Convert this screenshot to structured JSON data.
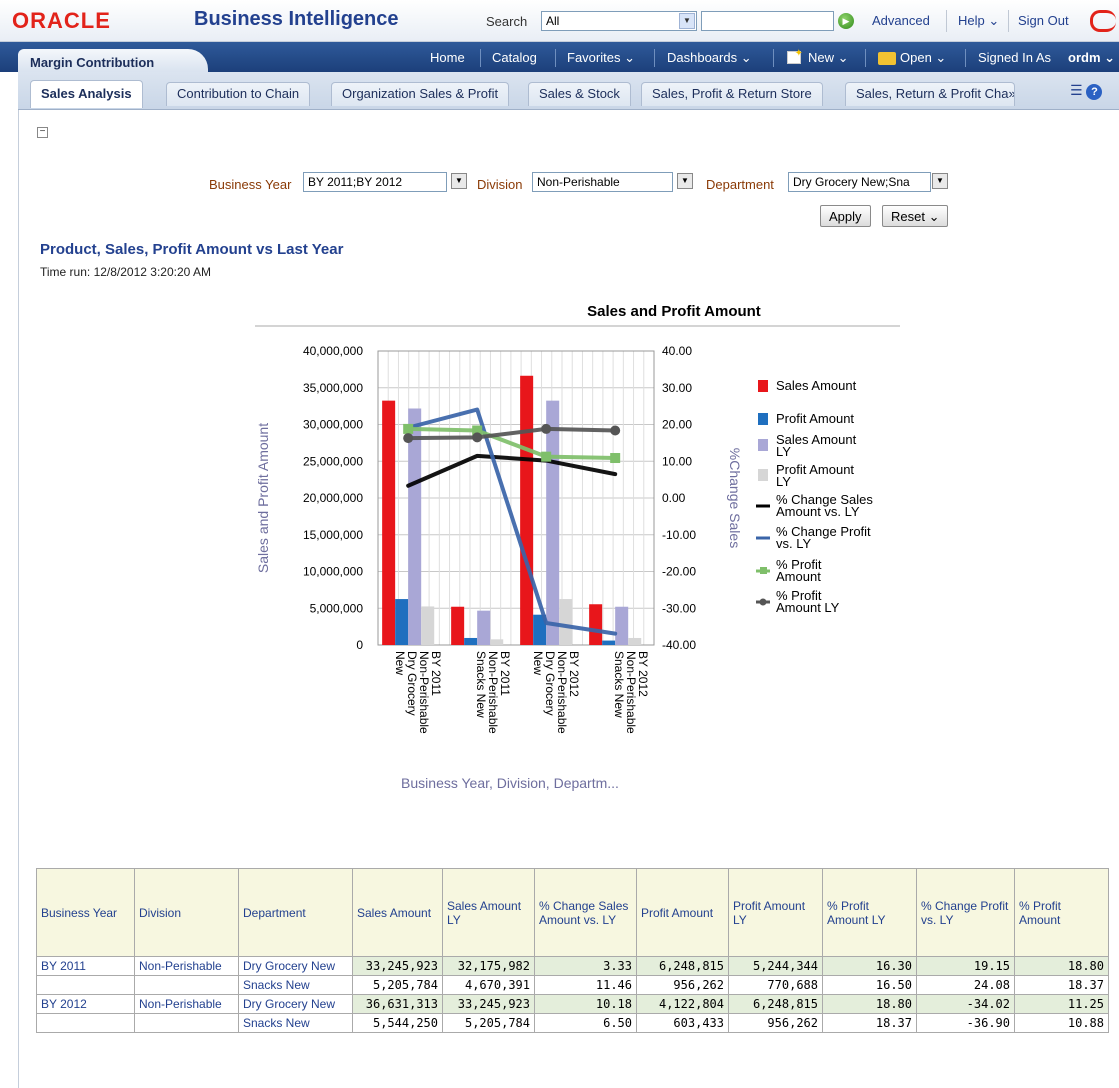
{
  "header": {
    "logo": "ORACLE",
    "product": "Business Intelligence",
    "search_label": "Search",
    "search_scope": "All",
    "advanced": "Advanced",
    "help": "Help ⌄",
    "signout": "Sign Out"
  },
  "nav": {
    "dashboard_title": "Margin Contribution",
    "home": "Home",
    "catalog": "Catalog",
    "favorites": "Favorites ⌄",
    "dashboards": "Dashboards ⌄",
    "new": "New ⌄",
    "open": "Open ⌄",
    "signed_in_as": "Signed In As",
    "user": "ordm ⌄"
  },
  "tabs": [
    "Sales Analysis",
    "Contribution to Chain",
    "Organization Sales & Profit",
    "Sales & Stock",
    "Sales, Profit & Return Store",
    "Sales, Return & Profit Cha»"
  ],
  "prompts": {
    "business_year_label": "Business Year",
    "business_year_value": "BY 2011;BY 2012",
    "division_label": "Division",
    "division_value": "Non-Perishable",
    "department_label": "Department",
    "department_value": "Dry Grocery New;Sna",
    "apply": "Apply",
    "reset": "Reset ⌄"
  },
  "report": {
    "title": "Product, Sales, Profit Amount vs Last Year",
    "time_run": "Time run: 12/8/2012 3:20:20 AM"
  },
  "chart_data": {
    "type": "bar",
    "title": "Sales and Profit Amount",
    "ylabel": "Sales and Profit Amount",
    "y2label": "%Change Sales",
    "xlabel": "Business Year, Division, Departm...",
    "ylim": [
      0,
      40000000
    ],
    "y2lim": [
      -40,
      40
    ],
    "y_ticks": [
      "40,000,000",
      "35,000,000",
      "30,000,000",
      "25,000,000",
      "20,000,000",
      "15,000,000",
      "10,000,000",
      "5,000,000",
      "0"
    ],
    "y2_ticks": [
      "40.00",
      "30.00",
      "20.00",
      "10.00",
      "0.00",
      "-10.00",
      "-20.00",
      "-30.00",
      "-40.00"
    ],
    "categories": [
      [
        "BY 2011",
        "Non-Perishable",
        "Dry Grocery",
        "New"
      ],
      [
        "BY 2011",
        "Non-Perishable",
        "Snacks New"
      ],
      [
        "BY 2012",
        "Non-Perishable",
        "Dry Grocery",
        "New"
      ],
      [
        "BY 2012",
        "Non-Perishable",
        "Snacks New"
      ]
    ],
    "bar_series": [
      {
        "name": "Sales Amount",
        "color": "#e8161b",
        "values": [
          33245923,
          5205784,
          36631313,
          5544250
        ]
      },
      {
        "name": "Profit Amount",
        "color": "#1f6fbf",
        "values": [
          6248815,
          956262,
          4122804,
          603433
        ]
      },
      {
        "name": "Sales Amount LY",
        "color": "#a9a7d6",
        "values": [
          32175982,
          4670391,
          33245923,
          5205784
        ]
      },
      {
        "name": "Profit Amount LY",
        "color": "#d6d6d6",
        "values": [
          5244344,
          770688,
          6248815,
          956262
        ]
      }
    ],
    "line_series": [
      {
        "name": "% Change Sales Amount vs. LY",
        "color": "#000000",
        "values": [
          3.33,
          11.46,
          10.18,
          6.5
        ]
      },
      {
        "name": "% Change Profit vs. LY",
        "color": "#3a64a8",
        "values": [
          19.15,
          24.08,
          -34.02,
          -36.9
        ]
      },
      {
        "name": "% Profit Amount",
        "color": "#7fbf6a",
        "values": [
          18.8,
          18.37,
          11.25,
          10.88
        ]
      },
      {
        "name": "% Profit Amount LY",
        "color": "#555555",
        "values": [
          16.3,
          16.5,
          18.8,
          18.37
        ]
      }
    ],
    "legend": [
      {
        "label": "Sales Amount",
        "lines": [
          "Sales Amount"
        ]
      },
      {
        "label": "Profit Amount",
        "lines": [
          "Profit Amount"
        ]
      },
      {
        "label": "Sales Amount LY",
        "lines": [
          "Sales Amount",
          "LY"
        ]
      },
      {
        "label": "Profit Amount LY",
        "lines": [
          "Profit Amount",
          "LY"
        ]
      },
      {
        "label": "% Change Sales Amount vs. LY",
        "lines": [
          "% Change Sales",
          "Amount vs. LY"
        ]
      },
      {
        "label": "% Change Profit vs. LY",
        "lines": [
          "% Change Profit",
          "vs. LY"
        ]
      },
      {
        "label": "% Profit Amount",
        "lines": [
          "% Profit",
          "Amount"
        ]
      },
      {
        "label": "% Profit Amount LY",
        "lines": [
          "% Profit",
          "Amount LY"
        ]
      }
    ],
    "legend_position": "right"
  },
  "table": {
    "headers": [
      "Business Year",
      "Division",
      "Department",
      "Sales Amount",
      "Sales Amount LY",
      "% Change Sales Amount vs. LY",
      "Profit Amount",
      "Profit Amount LY",
      "% Profit Amount LY",
      "% Change Profit vs. LY",
      "% Profit Amount"
    ],
    "rows": [
      {
        "year": "BY 2011",
        "division": "Non-Perishable",
        "department": "Dry Grocery New",
        "cells": [
          "33,245,923",
          "32,175,982",
          "3.33",
          "6,248,815",
          "5,244,344",
          "16.30",
          "19.15",
          "18.80"
        ]
      },
      {
        "year": "",
        "division": "",
        "department": "Snacks New",
        "cells": [
          "5,205,784",
          "4,670,391",
          "11.46",
          "956,262",
          "770,688",
          "16.50",
          "24.08",
          "18.37"
        ]
      },
      {
        "year": "BY 2012",
        "division": "Non-Perishable",
        "department": "Dry Grocery New",
        "cells": [
          "36,631,313",
          "33,245,923",
          "10.18",
          "4,122,804",
          "6,248,815",
          "18.80",
          "-34.02",
          "11.25"
        ]
      },
      {
        "year": "",
        "division": "",
        "department": "Snacks New",
        "cells": [
          "5,544,250",
          "5,205,784",
          "6.50",
          "603,433",
          "956,262",
          "18.37",
          "-36.90",
          "10.88"
        ]
      }
    ]
  }
}
